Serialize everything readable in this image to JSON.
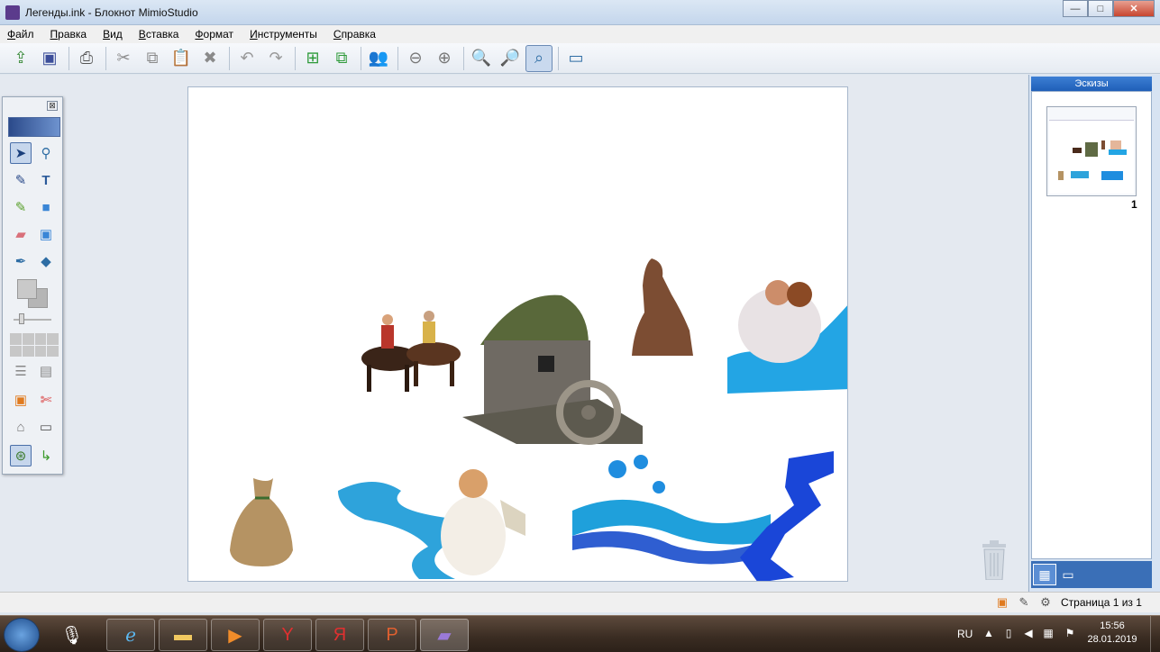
{
  "window": {
    "title": "Легенды.ink - Блокнот MimioStudio",
    "minimize": "—",
    "maximize": "□",
    "close": "✕"
  },
  "menu": {
    "items": [
      "Файл",
      "Правка",
      "Вид",
      "Вставка",
      "Формат",
      "Инструменты",
      "Справка"
    ]
  },
  "toolbar": {
    "icons": [
      "open-icon",
      "save-icon",
      "print-icon",
      "cut-icon",
      "copy-icon",
      "paste-icon",
      "delete-icon",
      "undo-icon",
      "redo-icon",
      "new-page-icon",
      "duplicate-page-icon",
      "collaborate-icon",
      "back-icon",
      "forward-icon",
      "zoom-in-icon",
      "zoom-out-icon",
      "zoom-fit-icon",
      "screen-icon"
    ]
  },
  "palette": {
    "close": "⊠"
  },
  "sidepane": {
    "header": "Эскизы",
    "page_number": "1"
  },
  "status": {
    "page_label": "Страница 1 из 1"
  },
  "taskbar": {
    "language": "RU",
    "time": "15:56",
    "date": "28.01.2019"
  }
}
